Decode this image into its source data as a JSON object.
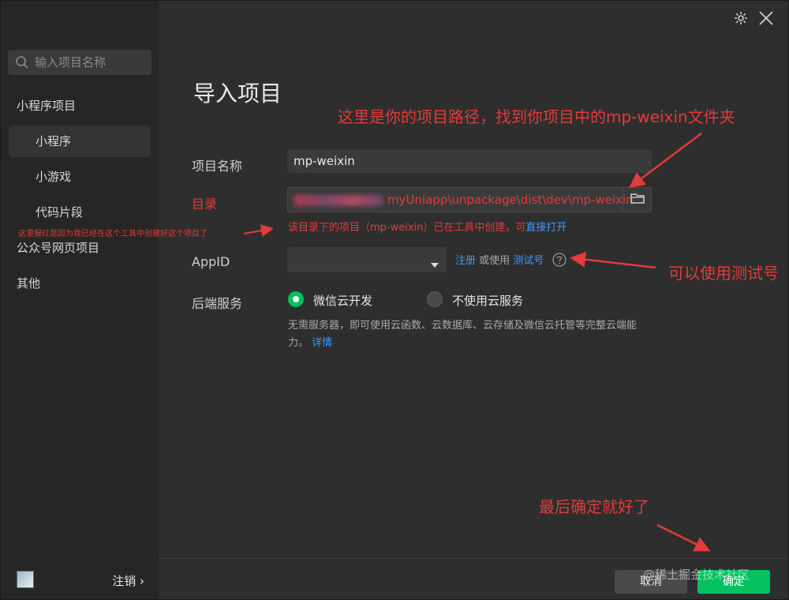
{
  "window": {
    "icons": {
      "settings": "gear-icon",
      "close": "close-icon"
    }
  },
  "sidebar": {
    "search_placeholder": "输入项目名称",
    "items": [
      {
        "label": "小程序项目"
      },
      {
        "label": "小程序"
      },
      {
        "label": "小游戏"
      },
      {
        "label": "代码片段"
      },
      {
        "label": "公众号网页项目"
      },
      {
        "label": "其他"
      }
    ],
    "logout_label": "注销 ›"
  },
  "form": {
    "title": "导入项目",
    "name_label": "项目名称",
    "name_value": "mp-weixin",
    "dir_label": "目录",
    "dir_value": "myUniapp\\unpackage\\dist\\dev\\mp-weixin",
    "dir_note_prefix": "该目录下的项目（mp-weixin）已在工具中创建，可",
    "dir_note_link": "直接打开",
    "appid_label": "AppID",
    "appid_value": "",
    "register_link": "注册",
    "or_use": "或使用",
    "test_link": "测试号",
    "backend_label": "后端服务",
    "opt_cloud": "微信云开发",
    "opt_none": "不使用云服务",
    "cloud_desc_1": "无需服务器，即可使用云函数、云数据库、云存储及微信云托管等完整云端能",
    "cloud_desc_2": "力。",
    "details_link": "详情"
  },
  "footer": {
    "cancel": "取消",
    "confirm": "确定"
  },
  "annotations": {
    "path_hint": "这里是你的项目路径，找到你项目中的mp-weixin文件夹",
    "red_hint": "这里报红是因为我已经在这个工具中创建好这个项目了",
    "test_hint": "可以使用测试号",
    "confirm_hint": "最后确定就好了"
  },
  "watermark": "@稀土掘金技术社区",
  "colors": {
    "accent_green": "#07c160",
    "link_blue": "#3d9bff",
    "annotation_red": "#e53a3a"
  }
}
